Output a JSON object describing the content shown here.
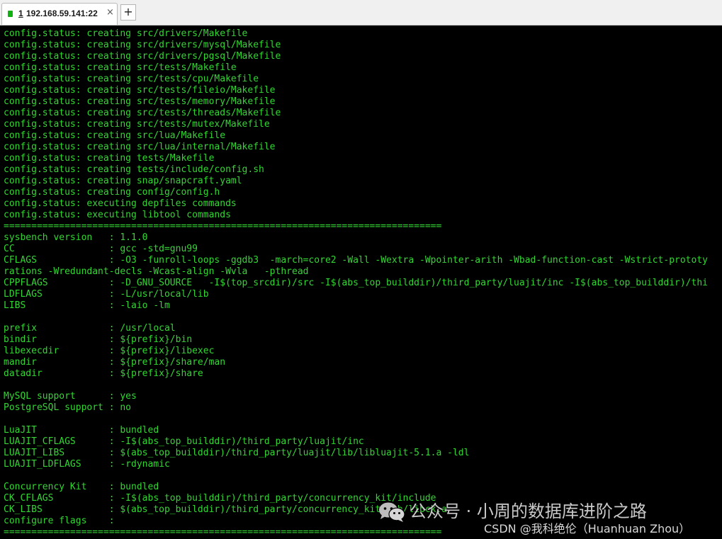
{
  "tab": {
    "number": "1",
    "title": "192.168.59.141:22",
    "close_glyph": "×",
    "status_icon": "session-connected-icon",
    "status_color": "#12b012"
  },
  "add_tab": {
    "glyph": "+"
  },
  "terminal": {
    "text_color": "#33d633",
    "background": "#000000",
    "lines": [
      "config.status: creating src/drivers/Makefile",
      "config.status: creating src/drivers/mysql/Makefile",
      "config.status: creating src/drivers/pgsql/Makefile",
      "config.status: creating src/tests/Makefile",
      "config.status: creating src/tests/cpu/Makefile",
      "config.status: creating src/tests/fileio/Makefile",
      "config.status: creating src/tests/memory/Makefile",
      "config.status: creating src/tests/threads/Makefile",
      "config.status: creating src/tests/mutex/Makefile",
      "config.status: creating src/lua/Makefile",
      "config.status: creating src/lua/internal/Makefile",
      "config.status: creating tests/Makefile",
      "config.status: creating tests/include/config.sh",
      "config.status: creating snap/snapcraft.yaml",
      "config.status: creating config/config.h",
      "config.status: executing depfiles commands",
      "config.status: executing libtool commands",
      "===============================================================================",
      "sysbench version   : 1.1.0",
      "CC                 : gcc -std=gnu99",
      "CFLAGS             : -O3 -funroll-loops -ggdb3  -march=core2 -Wall -Wextra -Wpointer-arith -Wbad-function-cast -Wstrict-prototy",
      "rations -Wredundant-decls -Wcast-align -Wvla   -pthread",
      "CPPFLAGS           : -D_GNU_SOURCE   -I$(top_srcdir)/src -I$(abs_top_builddir)/third_party/luajit/inc -I$(abs_top_builddir)/thi",
      "LDFLAGS            : -L/usr/local/lib",
      "LIBS               : -laio -lm",
      "",
      "prefix             : /usr/local",
      "bindir             : ${prefix}/bin",
      "libexecdir         : ${prefix}/libexec",
      "mandir             : ${prefix}/share/man",
      "datadir            : ${prefix}/share",
      "",
      "MySQL support      : yes",
      "PostgreSQL support : no",
      "",
      "LuaJIT             : bundled",
      "LUAJIT_CFLAGS      : -I$(abs_top_builddir)/third_party/luajit/inc",
      "LUAJIT_LIBS        : $(abs_top_builddir)/third_party/luajit/lib/libluajit-5.1.a -ldl",
      "LUAJIT_LDFLAGS     : -rdynamic",
      "",
      "Concurrency Kit    : bundled",
      "CK_CFLAGS          : -I$(abs_top_builddir)/third_party/concurrency_kit/include",
      "CK_LIBS            : $(abs_top_builddir)/third_party/concurrency_kit/lib/libck.a",
      "configure flags    :",
      "==============================================================================="
    ]
  },
  "watermark": {
    "icon": "wechat-icon",
    "main": "公众号 · 小周的数据库进阶之路",
    "sub": "CSDN @我科绝伦（Huanhuan Zhou）"
  }
}
